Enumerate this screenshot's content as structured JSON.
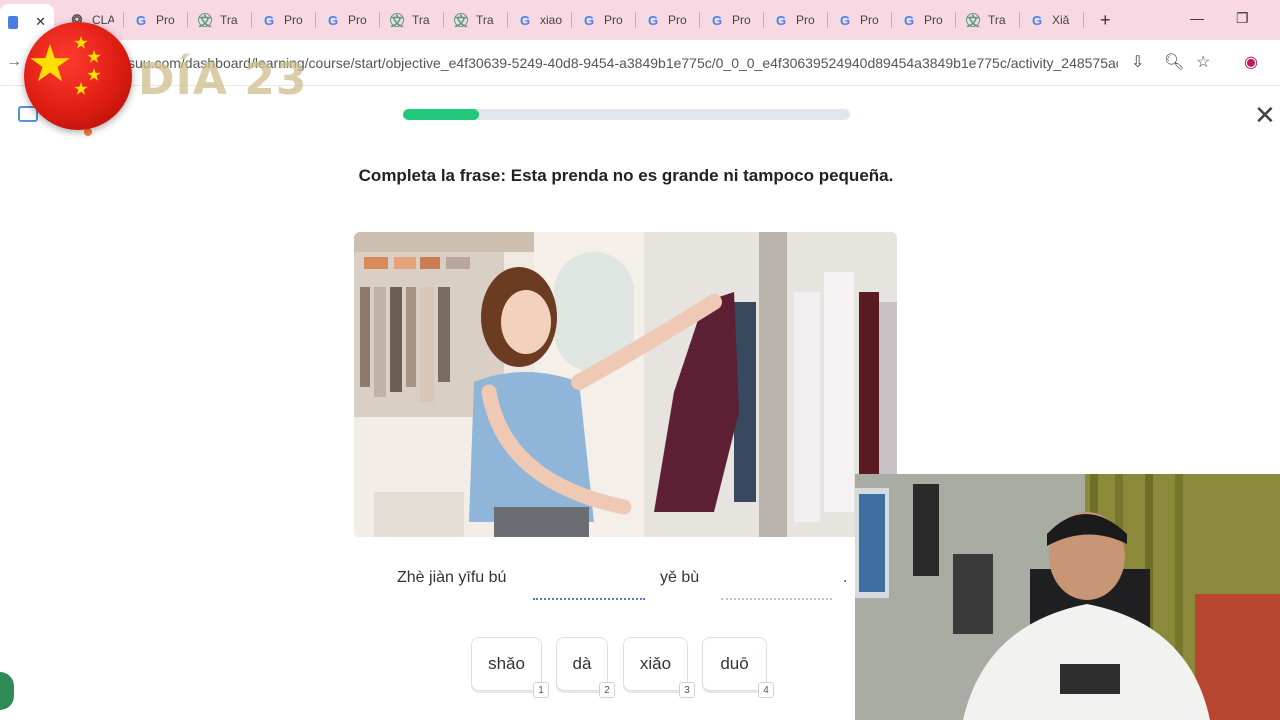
{
  "browser": {
    "tabs": [
      {
        "title": "",
        "icon": "doc-icon",
        "active": true
      },
      {
        "title": "CLA",
        "icon": "ai-icon"
      },
      {
        "title": "Pro",
        "icon": "google-icon"
      },
      {
        "title": "Tra",
        "icon": "translate-icon"
      },
      {
        "title": "Pro",
        "icon": "google-icon"
      },
      {
        "title": "Pro",
        "icon": "google-icon"
      },
      {
        "title": "Tra",
        "icon": "translate-icon"
      },
      {
        "title": "Tra",
        "icon": "translate-icon"
      },
      {
        "title": "xiao",
        "icon": "google-icon"
      },
      {
        "title": "Pro",
        "icon": "google-icon"
      },
      {
        "title": "Pro",
        "icon": "google-icon"
      },
      {
        "title": "Pro",
        "icon": "google-icon"
      },
      {
        "title": "Pro",
        "icon": "google-icon"
      },
      {
        "title": "Pro",
        "icon": "google-icon"
      },
      {
        "title": "Pro",
        "icon": "google-icon"
      },
      {
        "title": "Tra",
        "icon": "translate-icon"
      },
      {
        "title": "Xiǎ",
        "icon": "google-icon"
      }
    ],
    "new_tab": "+",
    "url": "suu.com/dashboard/learning/course/start/objective_e4f30639-5249-40d8-9454-a3849b1e775c/0_0_0_e4f30639524940d89454a3849b1e775c/activity_248575ac-..."
  },
  "overlay": {
    "day_label": "DÍA 23"
  },
  "lesson": {
    "progress": 0.17,
    "instruction": "Completa la frase: Esta prenda no es grande ni tampoco pequeña.",
    "sentence_part_1": "Zhè jiàn yīfu bú",
    "sentence_part_2": "yě bù",
    "sentence_end": ".",
    "choices": [
      {
        "label": "shǎo",
        "key": "1"
      },
      {
        "label": "dà",
        "key": "2"
      },
      {
        "label": "xiǎo",
        "key": "3"
      },
      {
        "label": "duō",
        "key": "4"
      }
    ]
  },
  "colors": {
    "progress_fill": "#22c97a",
    "tabstrip": "#f8d8e3",
    "blank_active": "#4f7bd1"
  }
}
